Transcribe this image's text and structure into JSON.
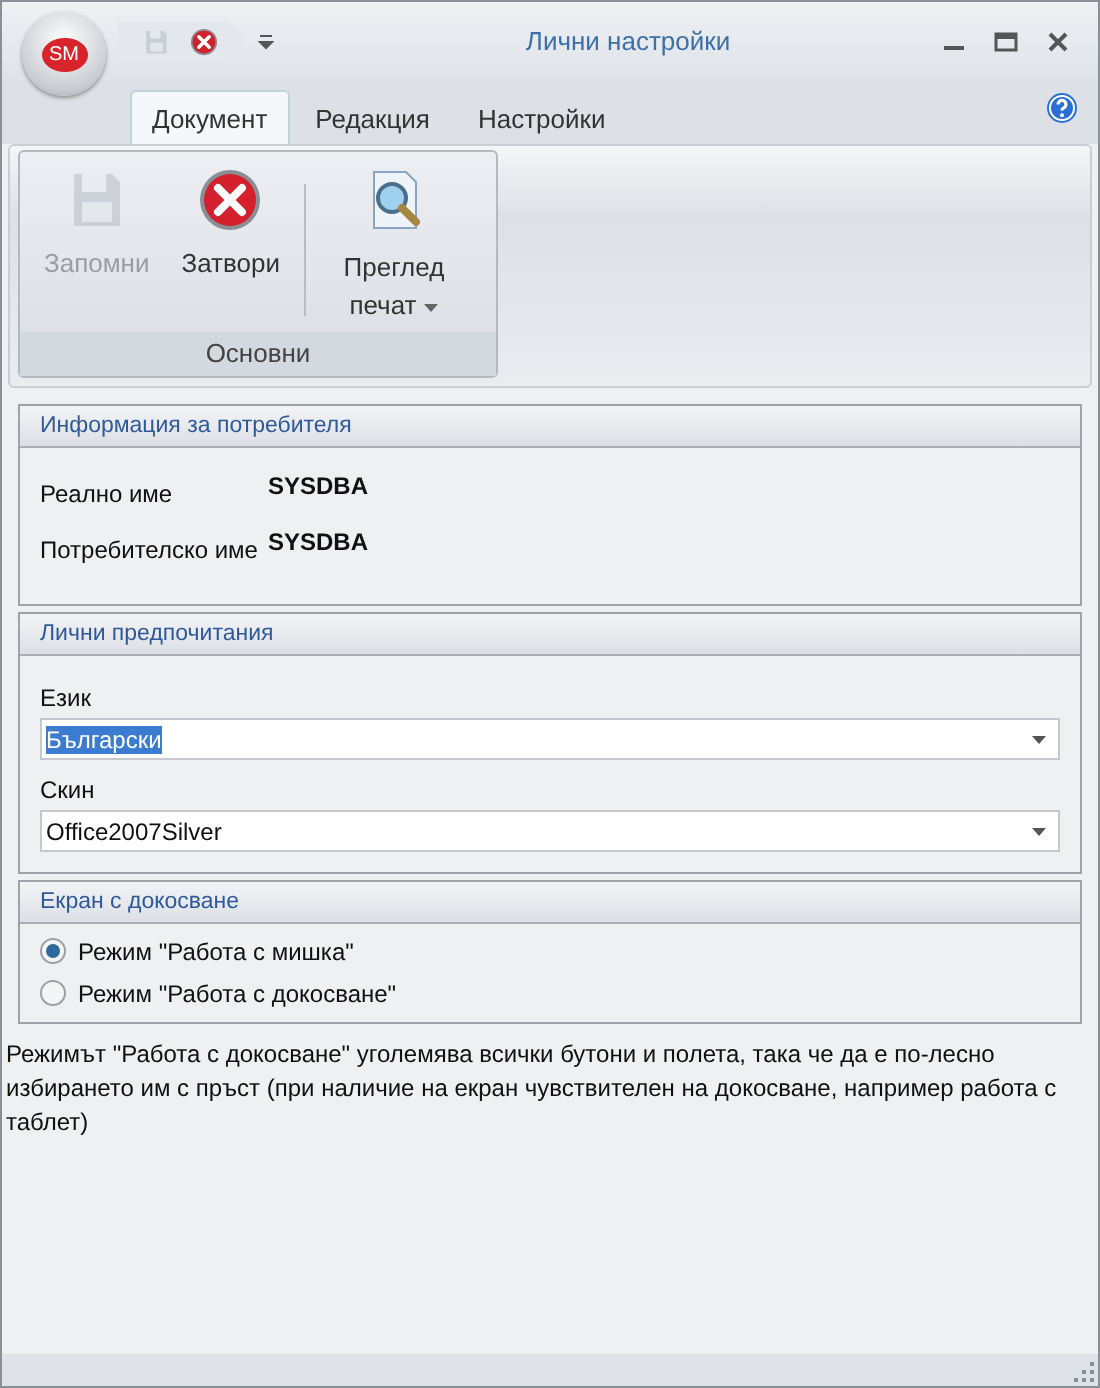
{
  "window": {
    "title": "Лични настройки",
    "logo": "SM"
  },
  "quick_access": [
    {
      "kind": "save",
      "disabled": true
    },
    {
      "kind": "close",
      "disabled": false
    }
  ],
  "tabs": [
    {
      "label": "Документ",
      "selected": true
    },
    {
      "label": "Редакция",
      "selected": false
    },
    {
      "label": "Настройки",
      "selected": false
    }
  ],
  "ribbon": {
    "groups": [
      {
        "label": "Основни",
        "buttons": [
          {
            "kind": "save",
            "label": "Запомни",
            "disabled": true,
            "dropdown": false
          },
          {
            "kind": "close",
            "label": "Затвори",
            "disabled": false,
            "dropdown": false
          },
          {
            "kind": "preview",
            "label": "Преглед печат",
            "disabled": false,
            "dropdown": true
          }
        ]
      }
    ]
  },
  "sections": [
    {
      "kind": "info",
      "title": "Информация за потребителя",
      "rows": [
        {
          "label": "Реално име",
          "value": "SYSDBA"
        },
        {
          "label": "Потребителско име",
          "value": "SYSDBA"
        }
      ]
    },
    {
      "kind": "form",
      "title": "Лични предпочитания",
      "fields": [
        {
          "label": "Език",
          "value": "Български",
          "highlighted": true
        },
        {
          "label": "Скин",
          "value": "Office2007Silver",
          "highlighted": false
        }
      ]
    },
    {
      "kind": "radios",
      "title": "Екран с докосване",
      "options": [
        {
          "label": "Режим \"Работа с мишка\"",
          "selected": true
        },
        {
          "label": "Режим \"Работа с докосване\"",
          "selected": false
        }
      ]
    }
  ],
  "description": "Режимът \"Работа с докосване\" уголемява всички бутони и полета, така че да е по-лесно избирането им с пръст (при наличие на екран чувствителен на докосване, например работа с таблет)"
}
